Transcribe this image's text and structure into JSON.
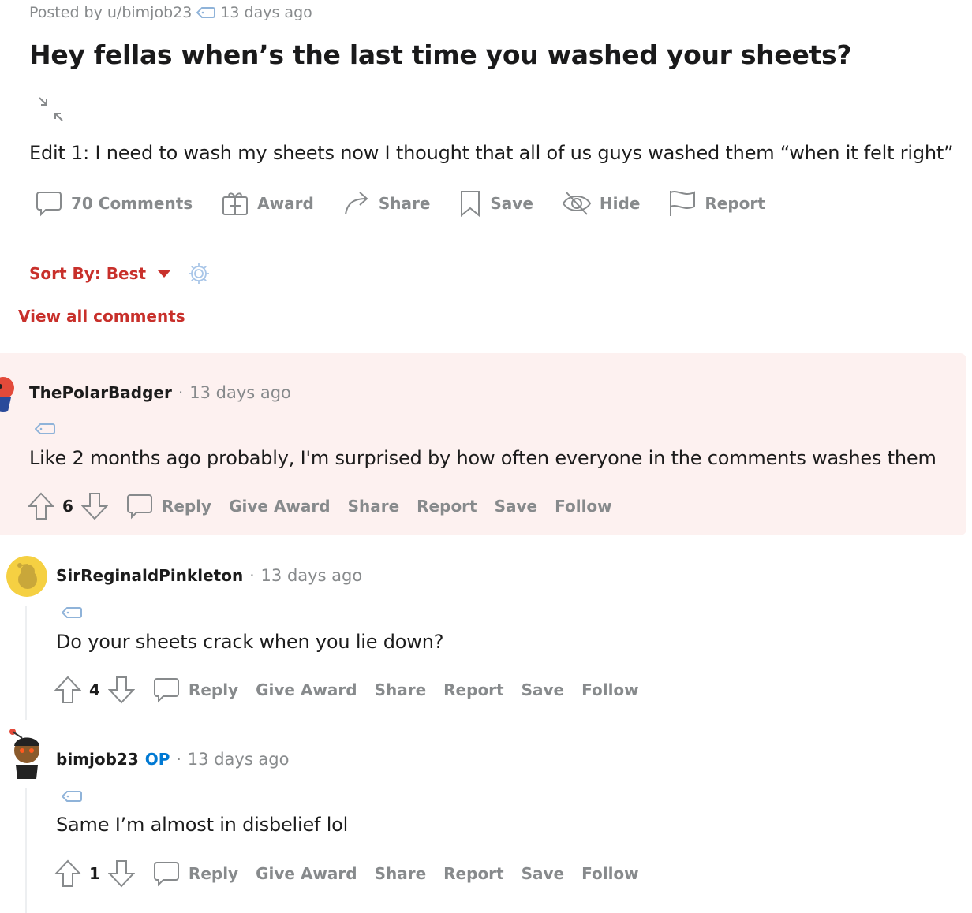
{
  "post": {
    "posted_by": "Posted by u/bimjob23",
    "time": "13 days ago",
    "title": "Hey fellas when’s the last time you washed your sheets?",
    "body": "Edit 1: I need to wash my sheets now I thought that all of us guys washed them “when it felt right”",
    "actions": {
      "comments": "70 Comments",
      "award": "Award",
      "share": "Share",
      "save": "Save",
      "hide": "Hide",
      "report": "Report"
    }
  },
  "sort": {
    "label": "Sort By: Best",
    "view_all": "View all comments"
  },
  "comments": [
    {
      "username": "ThePolarBadger",
      "time": "13 days ago",
      "text": "Like 2 months ago probably, I'm surprised by how often everyone in the comments washes them",
      "score": "6",
      "highlighted": true
    },
    {
      "username": "SirReginaldPinkleton",
      "time": "13 days ago",
      "text": "Do your sheets crack when you lie down?",
      "score": "4"
    },
    {
      "username": "bimjob23",
      "op_badge": "OP",
      "time": "13 days ago",
      "text": "Same I’m almost in disbelief lol",
      "score": "1"
    }
  ],
  "comment_actions": {
    "reply": "Reply",
    "give_award": "Give Award",
    "share": "Share",
    "report": "Report",
    "save": "Save",
    "follow": "Follow"
  },
  "icons": [
    "tag-icon",
    "collapse-icon",
    "comment-icon",
    "gift-icon",
    "share-arrow-icon",
    "bookmark-icon",
    "hide-eye-icon",
    "flag-icon",
    "caret-down-icon",
    "gear-icon",
    "upvote-icon",
    "downvote-icon"
  ],
  "colors": {
    "accent_red": "#c8302b",
    "highlight_bg": "#fdf1f0",
    "meta_gray": "#878a8c",
    "op_blue": "#0079d3"
  }
}
